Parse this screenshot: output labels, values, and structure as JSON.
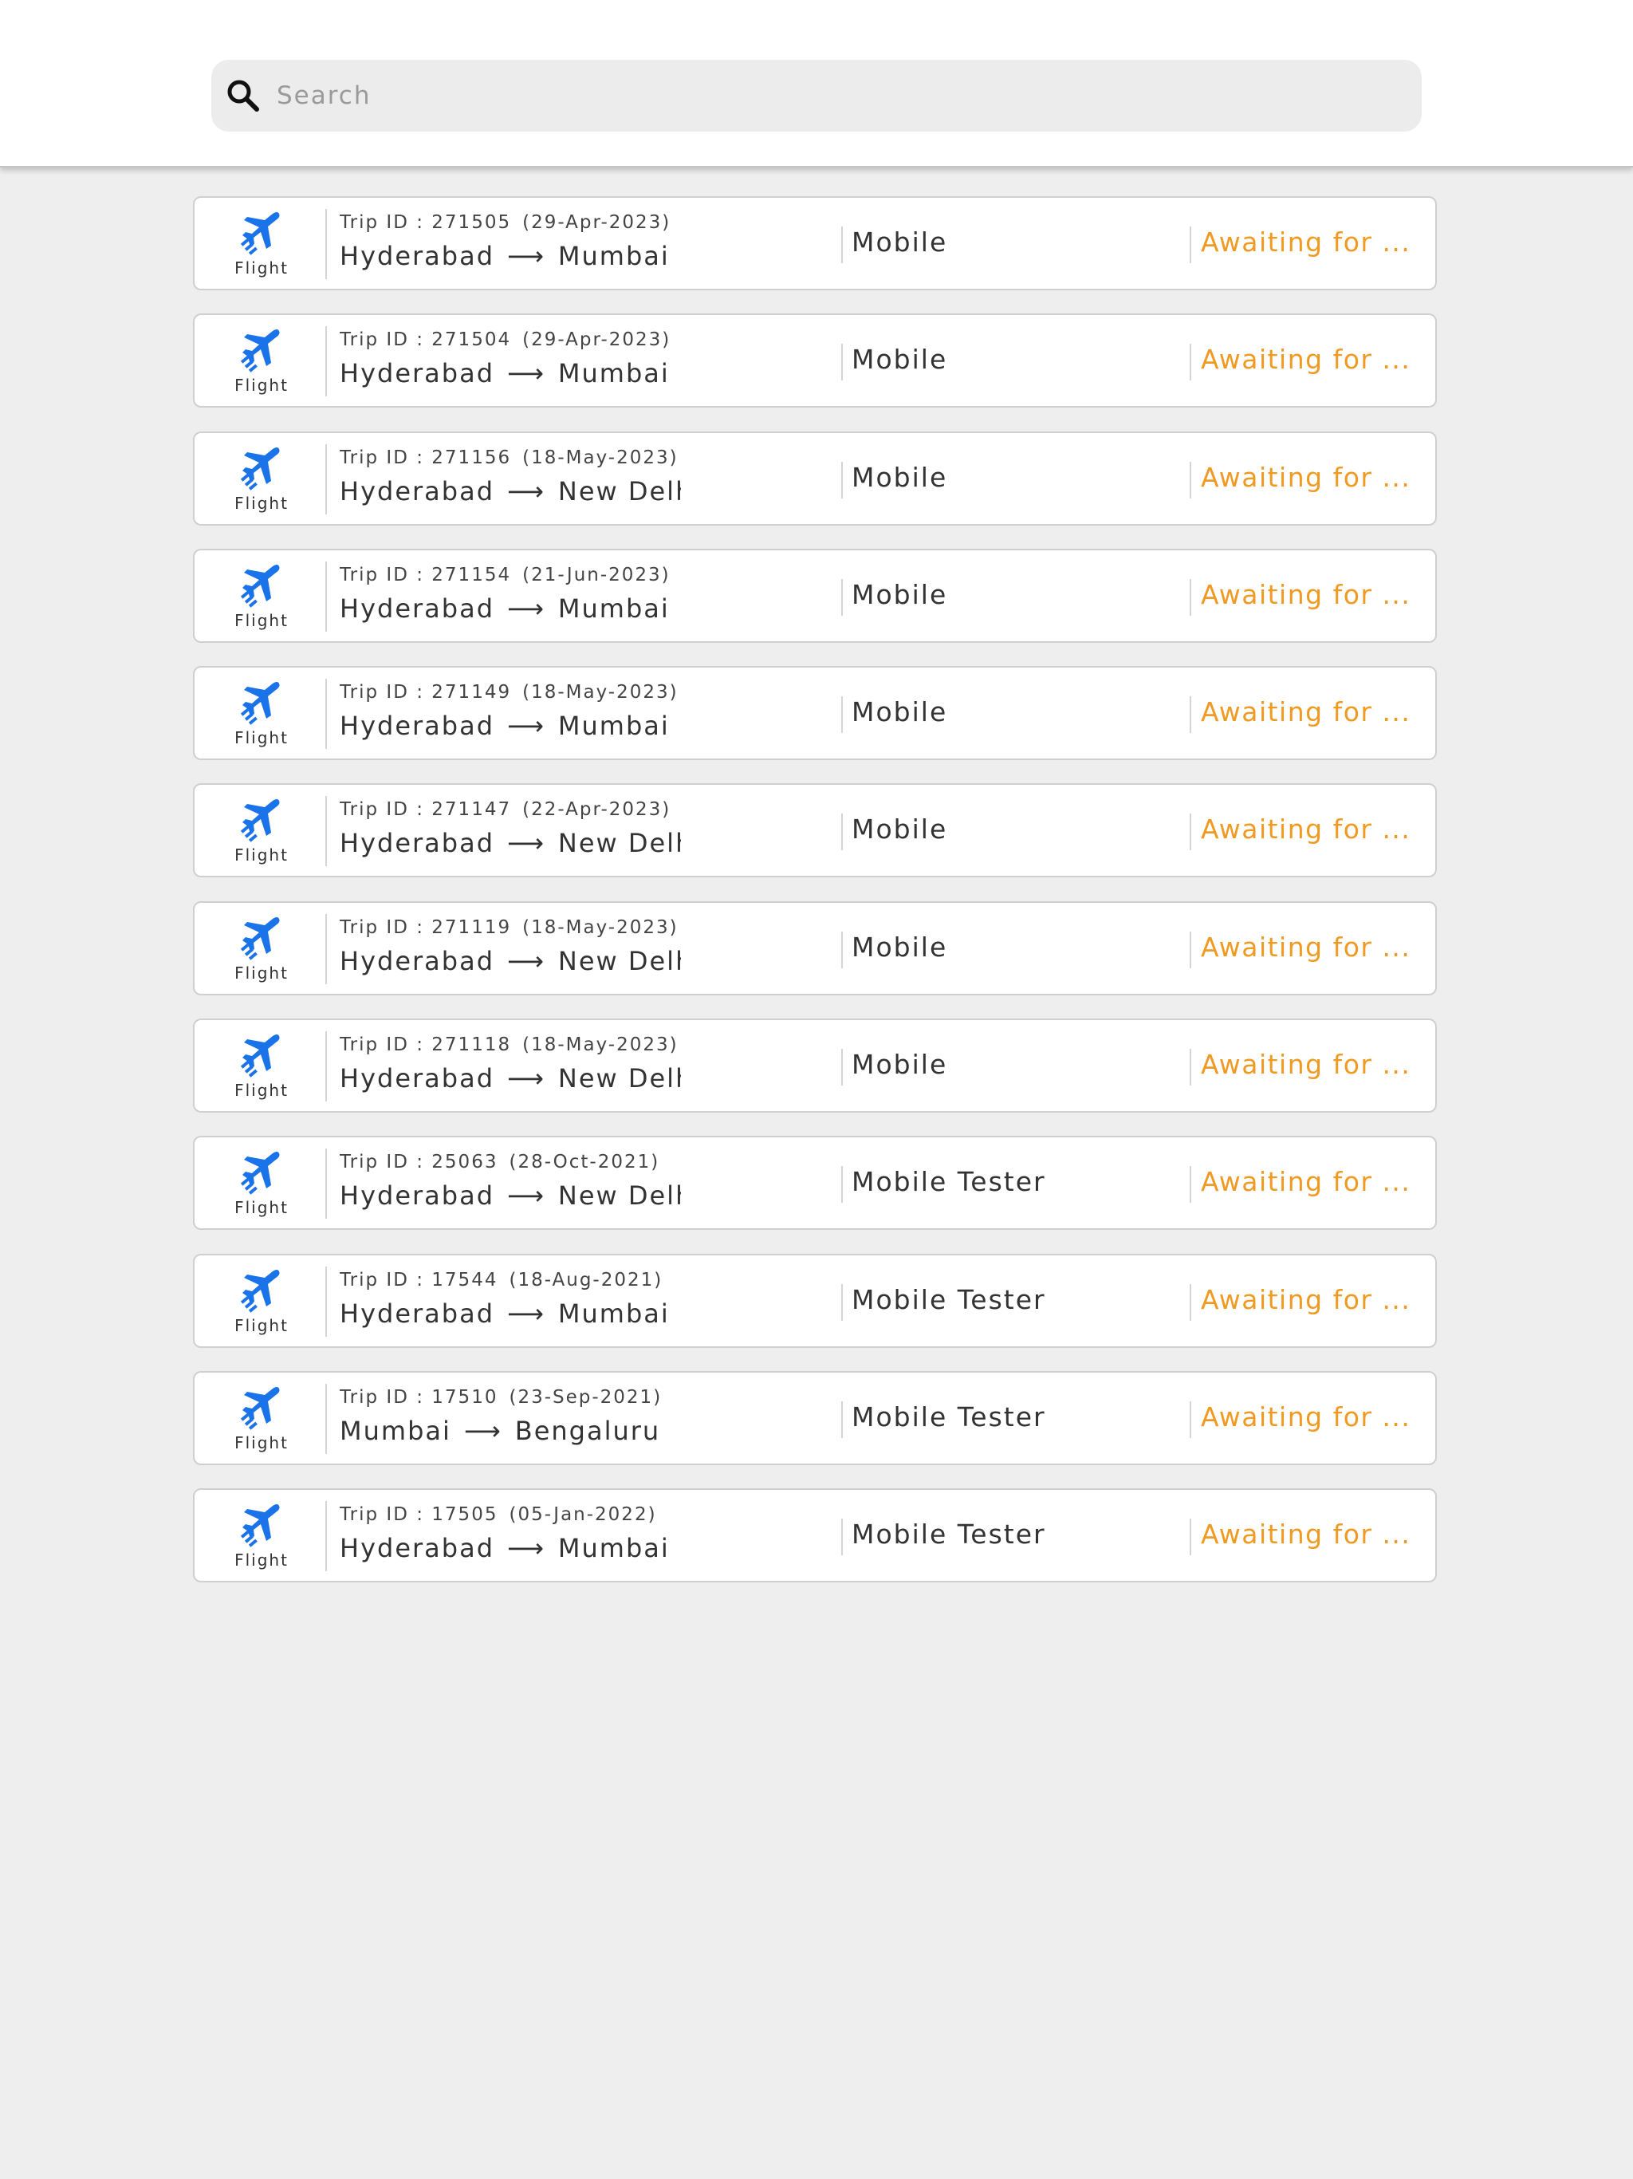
{
  "search": {
    "placeholder": "Search"
  },
  "colors": {
    "accent": "#1a73e8",
    "status": "#f09a22"
  },
  "trips": [
    {
      "mode": "Flight",
      "trip_id": "Trip ID : 271505",
      "date": "(29-Apr-2023)",
      "from": "Hyderabad",
      "arrow": "⟶",
      "to": "Mumbai",
      "traveler": "Mobile",
      "status": "Awaiting for ..."
    },
    {
      "mode": "Flight",
      "trip_id": "Trip ID : 271504",
      "date": "(29-Apr-2023)",
      "from": "Hyderabad",
      "arrow": "⟶",
      "to": "Mumbai",
      "traveler": "Mobile",
      "status": "Awaiting for ..."
    },
    {
      "mode": "Flight",
      "trip_id": "Trip ID : 271156",
      "date": "(18-May-2023)",
      "from": "Hyderabad",
      "arrow": "⟶",
      "to": "New Delhi",
      "traveler": "Mobile",
      "status": "Awaiting for ..."
    },
    {
      "mode": "Flight",
      "trip_id": "Trip ID : 271154",
      "date": "(21-Jun-2023)",
      "from": "Hyderabad",
      "arrow": "⟶",
      "to": "Mumbai",
      "traveler": "Mobile",
      "status": "Awaiting for ..."
    },
    {
      "mode": "Flight",
      "trip_id": "Trip ID : 271149",
      "date": "(18-May-2023)",
      "from": "Hyderabad",
      "arrow": "⟶",
      "to": "Mumbai",
      "traveler": "Mobile",
      "status": "Awaiting for ..."
    },
    {
      "mode": "Flight",
      "trip_id": "Trip ID : 271147",
      "date": "(22-Apr-2023)",
      "from": "Hyderabad",
      "arrow": "⟶",
      "to": "New Delhi",
      "traveler": "Mobile",
      "status": "Awaiting for ..."
    },
    {
      "mode": "Flight",
      "trip_id": "Trip ID : 271119",
      "date": "(18-May-2023)",
      "from": "Hyderabad",
      "arrow": "⟶",
      "to": "New Delhi",
      "traveler": "Mobile",
      "status": "Awaiting for ..."
    },
    {
      "mode": "Flight",
      "trip_id": "Trip ID : 271118",
      "date": "(18-May-2023)",
      "from": "Hyderabad",
      "arrow": "⟶",
      "to": "New Delhi",
      "traveler": "Mobile",
      "status": "Awaiting for ..."
    },
    {
      "mode": "Flight",
      "trip_id": "Trip ID : 25063",
      "date": "(28-Oct-2021)",
      "from": "Hyderabad",
      "arrow": "⟶",
      "to": "New Delhi",
      "traveler": "Mobile Tester",
      "status": "Awaiting for ..."
    },
    {
      "mode": "Flight",
      "trip_id": "Trip ID : 17544",
      "date": "(18-Aug-2021)",
      "from": "Hyderabad",
      "arrow": "⟶",
      "to": "Mumbai",
      "traveler": "Mobile Tester",
      "status": "Awaiting for ..."
    },
    {
      "mode": "Flight",
      "trip_id": "Trip ID : 17510",
      "date": "(23-Sep-2021)",
      "from": "Mumbai",
      "arrow": "⟶",
      "to": "Bengaluru",
      "traveler": "Mobile Tester",
      "status": "Awaiting for ..."
    },
    {
      "mode": "Flight",
      "trip_id": "Trip ID : 17505",
      "date": "(05-Jan-2022)",
      "from": "Hyderabad",
      "arrow": "⟶",
      "to": "Mumbai",
      "traveler": "Mobile Tester",
      "status": "Awaiting for ..."
    }
  ]
}
